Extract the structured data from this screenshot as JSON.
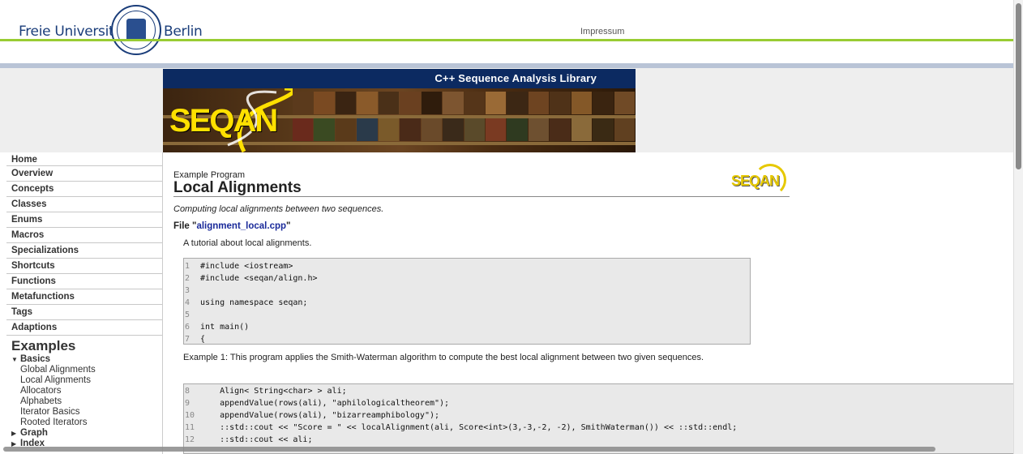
{
  "header": {
    "university_left": "Freie Universität",
    "university_right": "Berlin",
    "impressum": "Impressum"
  },
  "banner": {
    "title": "C++ Sequence Analysis Library",
    "logo_text": "SEQAN"
  },
  "sidebar": {
    "items": [
      {
        "label": "Home"
      },
      {
        "label": "Overview"
      },
      {
        "label": "Concepts"
      },
      {
        "label": "Classes"
      },
      {
        "label": "Enums"
      },
      {
        "label": "Macros"
      },
      {
        "label": "Specializations"
      },
      {
        "label": "Shortcuts"
      },
      {
        "label": "Functions"
      },
      {
        "label": "Metafunctions"
      },
      {
        "label": "Tags"
      },
      {
        "label": "Adaptions"
      }
    ],
    "examples_title": "Examples",
    "tree": {
      "basics": "Basics",
      "basics_items": [
        "Global Alignments",
        "Local Alignments",
        "Allocators",
        "Alphabets",
        "Iterator Basics",
        "Rooted Iterators"
      ],
      "graph": "Graph",
      "index": "Index"
    }
  },
  "content": {
    "breadcrumb": "Example Program",
    "title": "Local Alignments",
    "logo_text": "SEQAN",
    "subtitle": "Computing local alignments between two sequences.",
    "file_prefix": "File \"",
    "file_name": "alignment_local.cpp",
    "file_suffix": "\"",
    "tutorial": "A tutorial about local alignments.",
    "code1": [
      {
        "n": "1",
        "t": "#include <iostream>"
      },
      {
        "n": "2",
        "t": "#include <seqan/align.h>"
      },
      {
        "n": "3",
        "t": ""
      },
      {
        "n": "4",
        "t": "using namespace seqan;"
      },
      {
        "n": "5",
        "t": ""
      },
      {
        "n": "6",
        "t": "int main()"
      },
      {
        "n": "7",
        "t": "{"
      }
    ],
    "example_desc": "Example 1: This program applies the Smith-Waterman algorithm to compute the best local alignment between two given sequences.",
    "code2": [
      {
        "n": "8",
        "t": "    Align< String<char> > ali;"
      },
      {
        "n": "9",
        "t": "    appendValue(rows(ali), \"aphilologicaltheorem\");"
      },
      {
        "n": "10",
        "t": "    appendValue(rows(ali), \"bizarreamphibology\");"
      },
      {
        "n": "11",
        "t": "    ::std::cout << \"Score = \" << localAlignment(ali, Score<int>(3,-3,-2, -2), SmithWaterman()) << ::std::endl;"
      },
      {
        "n": "12",
        "t": "    ::std::cout << ali;"
      }
    ]
  },
  "colors": {
    "accent_green": "#99cc33",
    "banner_navy": "#0c2a61",
    "link_blue": "#1a2a9a",
    "logo_yellow": "#ffe000"
  }
}
